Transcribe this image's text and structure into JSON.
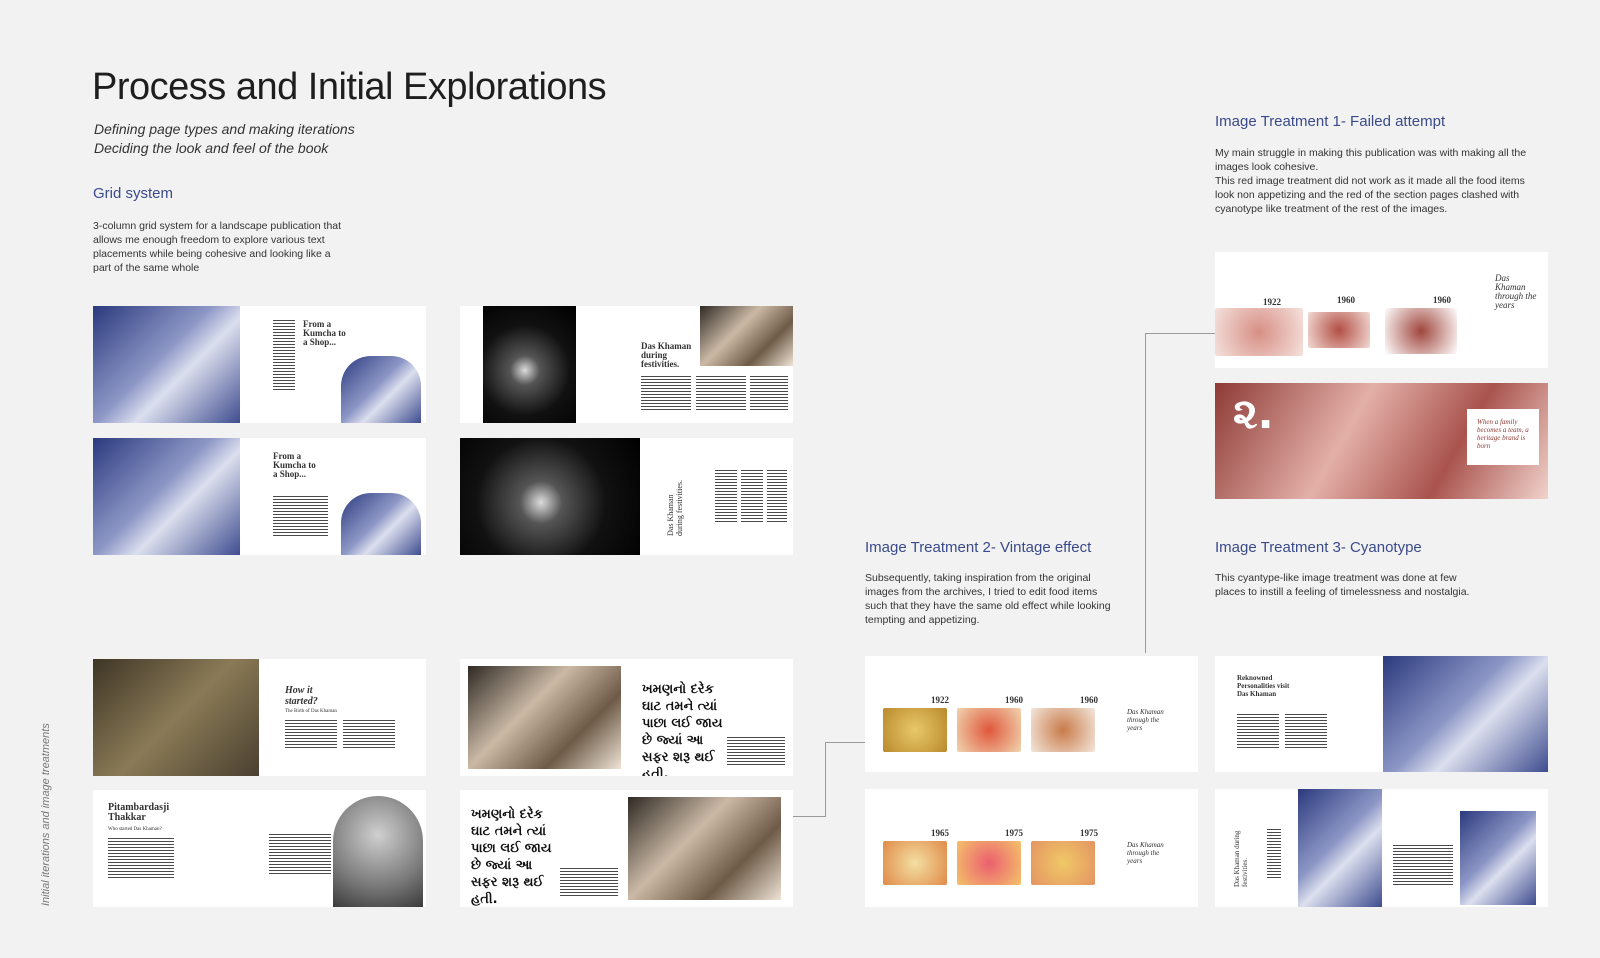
{
  "header": {
    "title": "Process and Initial Explorations",
    "subtitle_line1": "Defining page types and making iterations",
    "subtitle_line2": "Deciding the look and feel of the book"
  },
  "grid_system": {
    "heading": "Grid system",
    "body": "3-column grid system for a landscape publication that allows me enough freedom to explore various text placements while being cohesive and looking like a part of the same whole"
  },
  "treatment1": {
    "heading": "Image Treatment 1- Failed attempt",
    "body_line1": "My main struggle in making this publication was with making all the images look cohesive.",
    "body_line2": "This red image treatment did not work as it made all the food items look non appetizing and the red of the section pages clashed with cyanotype like treatment of the rest of the images."
  },
  "treatment2": {
    "heading": "Image Treatment 2- Vintage effect",
    "body": "Subsequently, taking inspiration from the original images from the archives, I tried to edit food items such that they have the same old effect while looking tempting and appetizing."
  },
  "treatment3": {
    "heading": "Image Treatment 3- Cyanotype",
    "body": "This cyantype-like image treatment was done at few places to instill a feeling of timelessness and nostalgia."
  },
  "side_label": "Initial iterations and image treatments",
  "spreads": {
    "kumcha_title": "From a Kumcha to a Shop...",
    "festivities_title": "Das Khaman during festivities.",
    "festivities_rot": "Das Khaman during festivities.",
    "started_title": "How it started?",
    "started_sub": "The Birth of Das Khaman",
    "pitambar_title": "Pitambardasji Thakkar",
    "pitambar_sub": "Who started Das Khaman?",
    "gujarati_text": "ખમણનો દરેક ઘાટ તમને ત્યાં પાછા લઈ જાય છે જ્યાં આ સફર શરૂ થઈ હતી.",
    "through_years": "Das Khaman through the years",
    "years_row1": [
      "1922",
      "1960",
      "1960"
    ],
    "years_row2": [
      "1965",
      "1975",
      "1975"
    ],
    "red_years": [
      "1922",
      "1960",
      "1960"
    ],
    "red_numeral": "૨.",
    "red_quote": "When a family becomes a team, a heritage brand is born",
    "personalities": "Reknowned Personalities visit Das Khaman"
  }
}
